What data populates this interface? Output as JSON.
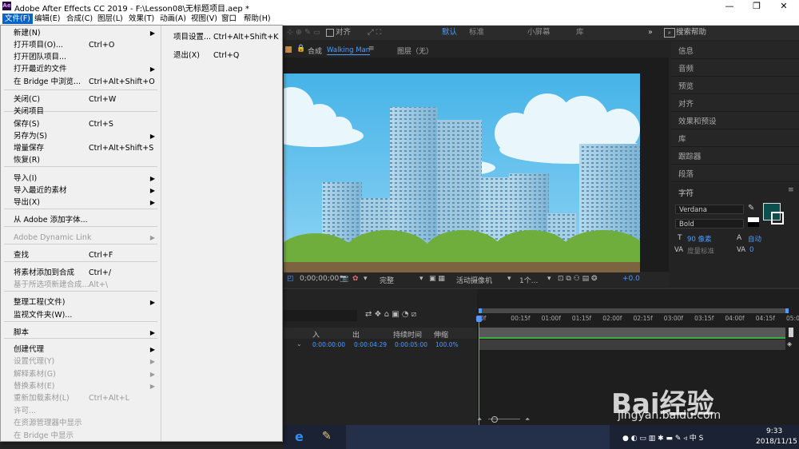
{
  "window": {
    "title": "Adobe After Effects CC 2019 - F:\\Lesson08\\无标题项目.aep *",
    "logo": "Ae",
    "minimize": "—",
    "maximize": "❐",
    "close": "✕"
  },
  "menubar": [
    "文件(F)",
    "编辑(E)",
    "合成(C)",
    "图层(L)",
    "效果(T)",
    "动画(A)",
    "视图(V)",
    "窗口",
    "帮助(H)"
  ],
  "toolbar": {
    "align": "对齐",
    "workspaces": [
      "默认",
      "标准",
      "小屏幕",
      "库"
    ],
    "more": "»",
    "search_placeholder": "搜索帮助"
  },
  "file_menu": {
    "items": [
      {
        "label": "新建(N)",
        "shortcut": "",
        "submenu": true,
        "disabled": false
      },
      {
        "label": "打开项目(O)...",
        "shortcut": "Ctrl+O",
        "submenu": false,
        "disabled": false
      },
      {
        "label": "打开团队项目...",
        "shortcut": "",
        "submenu": false,
        "disabled": false
      },
      {
        "label": "打开最近的文件",
        "shortcut": "",
        "submenu": true,
        "disabled": false
      },
      {
        "label": "在 Bridge 中浏览...",
        "shortcut": "Ctrl+Alt+Shift+O",
        "submenu": false,
        "disabled": false
      },
      {
        "label": "关闭(C)",
        "shortcut": "Ctrl+W",
        "submenu": false,
        "disabled": false
      },
      {
        "label": "关闭项目",
        "shortcut": "",
        "submenu": false,
        "disabled": false
      },
      {
        "label": "保存(S)",
        "shortcut": "Ctrl+S",
        "submenu": false,
        "disabled": false
      },
      {
        "label": "另存为(S)",
        "shortcut": "",
        "submenu": true,
        "disabled": false
      },
      {
        "label": "增量保存",
        "shortcut": "Ctrl+Alt+Shift+S",
        "submenu": false,
        "disabled": false
      },
      {
        "label": "恢复(R)",
        "shortcut": "",
        "submenu": false,
        "disabled": false
      },
      {
        "label": "导入(I)",
        "shortcut": "",
        "submenu": true,
        "disabled": false
      },
      {
        "label": "导入最近的素材",
        "shortcut": "",
        "submenu": true,
        "disabled": false
      },
      {
        "label": "导出(X)",
        "shortcut": "",
        "submenu": true,
        "disabled": false
      },
      {
        "label": "从 Adobe 添加字体...",
        "shortcut": "",
        "submenu": false,
        "disabled": false
      },
      {
        "label": "Adobe Dynamic Link",
        "shortcut": "",
        "submenu": true,
        "disabled": true
      },
      {
        "label": "查找",
        "shortcut": "Ctrl+F",
        "submenu": false,
        "disabled": false
      },
      {
        "label": "将素材添加到合成",
        "shortcut": "Ctrl+/",
        "submenu": false,
        "disabled": false
      },
      {
        "label": "基于所选项新建合成...",
        "shortcut": "Alt+\\",
        "submenu": false,
        "disabled": true
      },
      {
        "label": "整理工程(文件)",
        "shortcut": "",
        "submenu": true,
        "disabled": false
      },
      {
        "label": "监视文件夹(W)...",
        "shortcut": "",
        "submenu": false,
        "disabled": false
      },
      {
        "label": "脚本",
        "shortcut": "",
        "submenu": true,
        "disabled": false
      },
      {
        "label": "创建代理",
        "shortcut": "",
        "submenu": true,
        "disabled": false
      },
      {
        "label": "设置代理(Y)",
        "shortcut": "",
        "submenu": true,
        "disabled": true
      },
      {
        "label": "解释素材(G)",
        "shortcut": "",
        "submenu": true,
        "disabled": true
      },
      {
        "label": "替换素材(E)",
        "shortcut": "",
        "submenu": true,
        "disabled": true
      },
      {
        "label": "重新加载素材(L)",
        "shortcut": "Ctrl+Alt+L",
        "submenu": false,
        "disabled": true
      },
      {
        "label": "许可...",
        "shortcut": "",
        "submenu": false,
        "disabled": true
      },
      {
        "label": "在资源管理器中显示",
        "shortcut": "",
        "submenu": false,
        "disabled": true
      },
      {
        "label": "在 Bridge 中显示",
        "shortcut": "",
        "submenu": false,
        "disabled": true
      }
    ],
    "secondary": [
      {
        "label": "项目设置...",
        "shortcut": "Ctrl+Alt+Shift+K"
      },
      {
        "label": "退出(X)",
        "shortcut": "Ctrl+Q"
      }
    ]
  },
  "comp_panel": {
    "label": "合成",
    "comp_name": "Walking Man",
    "layer_tab": "图层（无）"
  },
  "comp_controls": {
    "timecode": "0;00;00;00",
    "resolution": "完整",
    "camera": "活动摄像机",
    "views": "1个...",
    "exposure": "+0.0"
  },
  "right_panel": {
    "items": [
      "信息",
      "音频",
      "预览",
      "对齐",
      "效果和预设",
      "库",
      "跟踪器",
      "段落"
    ],
    "character": {
      "title": "字符",
      "font": "Verdana",
      "style": "Bold",
      "font_size": "90 像素",
      "leading": "自动",
      "kerning": "度量标准",
      "tracking": "0"
    },
    "colors": {
      "fill": "#0b4f4f",
      "stroke": "#ffffff"
    }
  },
  "timeline": {
    "columns": [
      "入",
      "出",
      "持续时间",
      "伸缩"
    ],
    "values": [
      "0:00:00:00",
      "0:00:04:29",
      "0:00:05:00",
      "100.0%"
    ],
    "ruler": [
      "0f",
      "00:15f",
      "01:00f",
      "01:15f",
      "02:00f",
      "02:15f",
      "03:00f",
      "03:15f",
      "04:00f",
      "04:15f",
      "05:0"
    ]
  },
  "taskbar": {
    "time": "9:33",
    "date": "2018/11/15"
  },
  "watermark": {
    "brand": "Bai经验",
    "url": "jingyan.baidu.com"
  }
}
